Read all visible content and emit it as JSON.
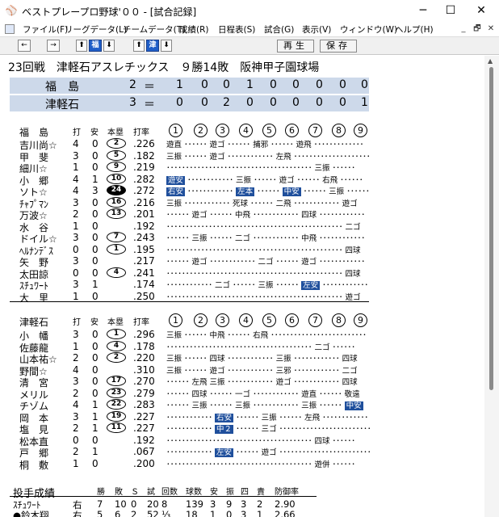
{
  "window": {
    "title": "ベストプレープロ野球'００ - [試合記録]",
    "minimize": "─",
    "maximize": "☐",
    "close": "✕"
  },
  "menu": [
    "ファイル(F)",
    "リーグデータ(L)",
    "チームデータ(T)",
    "成績(R)",
    "日程表(S)",
    "試合(G)",
    "表示(V)",
    "ウィンドウ(W)",
    "ヘルプ(H)"
  ],
  "mdi": [
    "_",
    "🗗",
    "✕"
  ],
  "toolbar": {
    "left": "←",
    "right": "→",
    "up1": "⬆",
    "team1": "福",
    "down1": "⬇",
    "up2": "⬆",
    "team2": "津",
    "down2": "⬇",
    "replay": "再生",
    "save": "保存"
  },
  "game": {
    "title": "23回戦　津軽石アスレチックス　９勝14敗　阪神甲子園球場",
    "teams": [
      {
        "name": "福　島",
        "runs": "2",
        "eq": "＝",
        "innings": [
          "1",
          "0",
          "0",
          "1",
          "0",
          "0",
          "0",
          "0",
          "0"
        ]
      },
      {
        "name": "津軽石",
        "runs": "3",
        "eq": "＝",
        "innings": [
          "0",
          "0",
          "2",
          "0",
          "0",
          "0",
          "0",
          "0",
          "1"
        ]
      }
    ]
  },
  "batting_headers": {
    "ab": "打",
    "h": "安",
    "hr": "本塁",
    "avg": "打率",
    "innings": [
      "1",
      "2",
      "3",
      "4",
      "5",
      "6",
      "7",
      "8",
      "9"
    ]
  },
  "fukushima": {
    "team": "福　島",
    "rows": [
      {
        "name": "吉川尚☆",
        "ab": "4",
        "h": "0",
        "hr": "2",
        "fill": false,
        "avg": ".226",
        "plays": "遊直 ･･････ 遊ゴ ･･････ 捕邪 ･･････ 遊飛 ･････････････"
      },
      {
        "name": "甲　斐",
        "ab": "3",
        "h": "0",
        "hr": "5",
        "fill": false,
        "avg": ".182",
        "plays": "三振 ･･････ 遊ゴ ････････････ 左飛 ････････････････････"
      },
      {
        "name": "細川☆",
        "ab": "1",
        "h": "0",
        "hr": "9",
        "fill": false,
        "avg": ".219",
        "plays": "･･････････････････････････････････････ 三振 ･･････"
      },
      {
        "name": "小　郷",
        "ab": "4",
        "h": "1",
        "hr": "10",
        "fill": false,
        "avg": ".282",
        "plays": "[遊安] ････････････ 三振 ･･････ 遊ゴ ･･････ 右飛 ･･････"
      },
      {
        "name": "ソト☆",
        "ab": "4",
        "h": "3",
        "hr": "24",
        "fill": true,
        "avg": ".272",
        "plays": "[右安] ････････････ [左本] ･･････ [中安] ･･････ 三振 ･･････"
      },
      {
        "name": "ﾁｬﾌﾟﾏﾝ",
        "ab": "3",
        "h": "0",
        "hr": "16",
        "fill": false,
        "avg": ".216",
        "plays": "三振 ････････････ 死球 ･･････ 二飛 ････････････ 遊ゴ"
      },
      {
        "name": "万波☆",
        "ab": "2",
        "h": "0",
        "hr": "13",
        "fill": false,
        "avg": ".201",
        "plays": "･･････ 遊ゴ ･･････ 中飛 ････････････ 四球 ････････････"
      },
      {
        "name": "水　谷",
        "ab": "1",
        "h": "0",
        "hr": "",
        "fill": false,
        "avg": ".192",
        "plays": "･･････････････････････････････････････････････ 二ゴ"
      },
      {
        "name": "ドイル☆",
        "ab": "3",
        "h": "0",
        "hr": "7",
        "fill": false,
        "avg": ".243",
        "plays": "･･････ 三振 ･･････ 二ゴ ････････････ 中飛 ････････････"
      },
      {
        "name": "ﾍﾙﾅﾝﾃﾞｽ",
        "ab": "0",
        "h": "0",
        "hr": "1",
        "fill": false,
        "avg": ".195",
        "plays": "･･････････････････････････････････････････････ 四球"
      },
      {
        "name": "矢　野",
        "ab": "3",
        "h": "0",
        "hr": "",
        "fill": false,
        "avg": ".217",
        "plays": "･･････ 遊ゴ ････････････ 二ゴ ･･････ 遊ゴ ････････････"
      },
      {
        "name": "太田諒",
        "ab": "0",
        "h": "0",
        "hr": "4",
        "fill": false,
        "avg": ".241",
        "plays": "･･････････････････････････････････････････････ 四球"
      },
      {
        "name": "ｽﾁｭﾜｰﾄ",
        "ab": "3",
        "h": "1",
        "hr": "",
        "fill": false,
        "avg": ".174",
        "plays": "････････････ 二ゴ ･･････ 三振 ･･････ [左安] ････････････"
      },
      {
        "name": "大　里",
        "ab": "1",
        "h": "0",
        "hr": "",
        "fill": false,
        "avg": ".250",
        "plays": "･･････････････････････････････････････････････ 遊ゴ"
      }
    ]
  },
  "tsugaruishi": {
    "team": "津軽石",
    "rows": [
      {
        "name": "小　幡",
        "ab": "3",
        "h": "0",
        "hr": "1",
        "fill": false,
        "avg": ".296",
        "plays": "三振 ･･････ 中飛 ･･････ 右飛 ･････････････････････････"
      },
      {
        "name": "佐藤龍",
        "ab": "1",
        "h": "0",
        "hr": "4",
        "fill": false,
        "avg": ".178",
        "plays": "･･････････････････････････････････････ 二ゴ ･･････"
      },
      {
        "name": "山本祐☆",
        "ab": "2",
        "h": "0",
        "hr": "2",
        "fill": false,
        "avg": ".220",
        "plays": "三振 ･･････ 四球 ････････････ 三振 ････････････ 四球"
      },
      {
        "name": "野間☆",
        "ab": "4",
        "h": "0",
        "hr": "",
        "fill": false,
        "avg": ".310",
        "plays": "三振 ･･････ 遊ゴ ････････････ 三邪 ････････････ 二ゴ"
      },
      {
        "name": "清　宮",
        "ab": "3",
        "h": "0",
        "hr": "17",
        "fill": false,
        "avg": ".270",
        "plays": "･･････ 左飛 三振 ････････････ 遊ゴ ････････････ 四球"
      },
      {
        "name": "メリル",
        "ab": "2",
        "h": "0",
        "hr": "23",
        "fill": false,
        "avg": ".279",
        "plays": "･･････ 四球 ･･････ 一ゴ ････････････ 遊直 ･･････ 敬遠"
      },
      {
        "name": "チゾム",
        "ab": "4",
        "h": "1",
        "hr": "22",
        "fill": false,
        "avg": ".283",
        "plays": "･･････ 三振 ･･････ 三振 ････････････ 三振 ･･････ [中安]"
      },
      {
        "name": "岡　本",
        "ab": "3",
        "h": "1",
        "hr": "19",
        "fill": false,
        "avg": ".227",
        "plays": "････････････ [右安] ･･････ 三振 ･･････ 左飛 ････････････"
      },
      {
        "name": "塩　見",
        "ab": "2",
        "h": "1",
        "hr": "11",
        "fill": false,
        "avg": ".227",
        "plays": "････････････ [中２] ･･････ 三ゴ ････････････････････････"
      },
      {
        "name": "松本直",
        "ab": "0",
        "h": "0",
        "hr": "",
        "fill": false,
        "avg": ".192",
        "plays": "･･････････････････････････････････････ 四球 ･･････"
      },
      {
        "name": "戸　郷",
        "ab": "2",
        "h": "1",
        "hr": "",
        "fill": false,
        "avg": ".067",
        "plays": "････････････ [左安] ･･････ 遊ゴ ････････････････････････"
      },
      {
        "name": "桐　敷",
        "ab": "1",
        "h": "0",
        "hr": "",
        "fill": false,
        "avg": ".200",
        "plays": "･･････････････････････････････････････ 遊併 ･･････"
      }
    ]
  },
  "pitching": {
    "title": "投手成績",
    "headers": [
      "勝",
      "敗",
      "Ｓ",
      "試",
      "回数",
      "球数",
      "安",
      "振",
      "四",
      "責",
      "防御率"
    ],
    "rows": [
      {
        "name": "ｽﾁｭﾜｰﾄ",
        "hand": "右",
        "vals": [
          "7",
          "10",
          "0",
          "20",
          "8",
          "139",
          "3",
          "9",
          "3",
          "2",
          "2.90"
        ]
      },
      {
        "name": "●鈴木翔",
        "hand": "右",
        "vals": [
          "5",
          "6",
          "2",
          "52",
          "⅓",
          "18",
          "1",
          "0",
          "3",
          "1",
          "2.66"
        ]
      }
    ]
  }
}
